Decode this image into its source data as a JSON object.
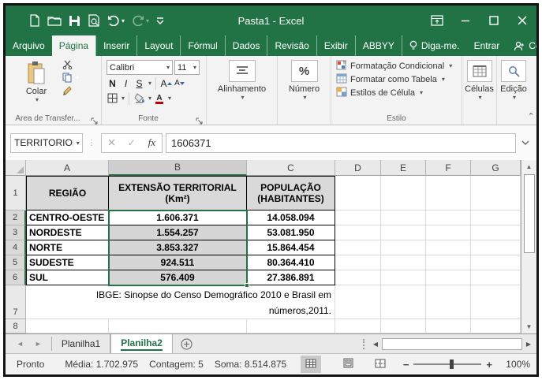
{
  "window": {
    "title": "Pasta1 - Excel"
  },
  "tabs": {
    "items": [
      "Arquivo",
      "Página",
      "Inserir",
      "Layout",
      "Fórmul",
      "Dados",
      "Revisão",
      "Exibir",
      "ABBYY"
    ],
    "active": "Página",
    "tell_me": "Diga-me.",
    "sign_in": "Entrar",
    "share": "Compartilhar"
  },
  "ribbon": {
    "clipboard": {
      "paste": "Colar",
      "group": "Área de Transfer..."
    },
    "font": {
      "name": "Calibri",
      "size": "11",
      "bold": "N",
      "italic": "I",
      "underline": "S",
      "grow": "A",
      "shrink": "A",
      "group": "Fonte"
    },
    "alignment": {
      "label": "Alinhamento"
    },
    "number": {
      "percent": "%",
      "label": "Número"
    },
    "style": {
      "conditional": "Formatação Condicional",
      "table": "Formatar como Tabela",
      "cellstyles": "Estilos de Célula",
      "group": "Estilo"
    },
    "cells": {
      "label": "Células"
    },
    "editing": {
      "label": "Edição"
    }
  },
  "formula_bar": {
    "name_box": "TERRITORIO",
    "fx": "fx",
    "value": "1606371"
  },
  "grid": {
    "columns": [
      "A",
      "B",
      "C",
      "D",
      "E",
      "F",
      "G"
    ],
    "rows": [
      "1",
      "2",
      "3",
      "4",
      "5",
      "6",
      "7",
      "8"
    ],
    "selected_column": "B",
    "selected_range": "B2:B6"
  },
  "table": {
    "header": {
      "region": "REGIÃO",
      "area_line1": "EXTENSÃO TERRITORIAL",
      "area_line2": "(Km²)",
      "pop_line1": "POPULAÇÃO",
      "pop_line2": "(HABITANTES)"
    },
    "rows": [
      {
        "region": "CENTRO-OESTE",
        "area": "1.606.371",
        "population": "14.058.094"
      },
      {
        "region": "NORDESTE",
        "area": "1.554.257",
        "population": "53.081.950"
      },
      {
        "region": "NORTE",
        "area": "3.853.327",
        "population": "15.864.454"
      },
      {
        "region": "SUDESTE",
        "area": "924.511",
        "population": "80.364.410"
      },
      {
        "region": "SUL",
        "area": "576.409",
        "population": "27.386.891"
      }
    ],
    "footnote_line1": "IBGE: Sinopse do Censo Demográfico 2010 e Brasil em",
    "footnote_line2": "números,2011."
  },
  "sheet_bar": {
    "tabs": [
      "Planilha1",
      "Planilha2"
    ],
    "active": "Planilha2"
  },
  "status_bar": {
    "mode": "Pronto",
    "average": "Média: 1.702.975",
    "count": "Contagem: 5",
    "sum": "Soma: 8.514.875",
    "zoom": "100%"
  },
  "icons": {
    "dropdown": "▾",
    "scroll_up": "▲",
    "scroll_down": "▼",
    "scroll_left": "◀",
    "scroll_right": "▶",
    "nav_left": "◄",
    "nav_right": "►",
    "check": "✓",
    "collapse_ribbon": "ˆ"
  },
  "colors": {
    "excel_green": "#217346",
    "header_fill": "#d9d9d9",
    "selection_fill": "#d6d6d6",
    "font_color_red": "#c00000"
  }
}
